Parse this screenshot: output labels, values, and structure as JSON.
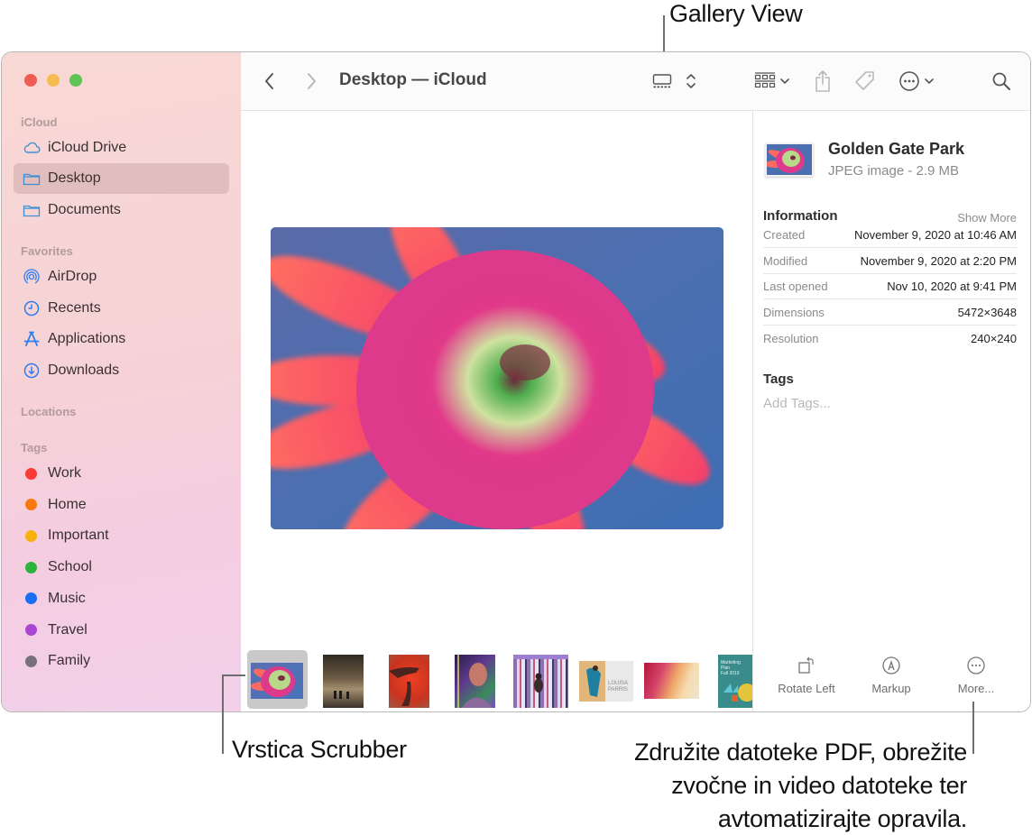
{
  "annotations": {
    "gallery_view": "Gallery View",
    "scrubber": "Vrstica Scrubber",
    "more_lines": [
      "Združite datoteke PDF, obrežite",
      "zvočne in video datoteke ter",
      "avtomatizirajte opravila."
    ]
  },
  "window": {
    "title": "Desktop — iCloud"
  },
  "sidebar": {
    "sections": [
      {
        "label": "iCloud"
      },
      {
        "label": "Favorites"
      },
      {
        "label": "Locations"
      },
      {
        "label": "Tags"
      }
    ],
    "icloud_items": [
      {
        "label": "iCloud Drive",
        "icon": "cloud-icon",
        "selected": false
      },
      {
        "label": "Desktop",
        "icon": "folder-icon",
        "selected": true
      },
      {
        "label": "Documents",
        "icon": "folder-icon",
        "selected": false
      }
    ],
    "favorite_items": [
      {
        "label": "AirDrop",
        "icon": "airdrop-icon"
      },
      {
        "label": "Recents",
        "icon": "clock-icon"
      },
      {
        "label": "Applications",
        "icon": "applications-icon"
      },
      {
        "label": "Downloads",
        "icon": "download-icon"
      }
    ],
    "tags": [
      {
        "label": "Work",
        "color": "#fa3a35"
      },
      {
        "label": "Home",
        "color": "#f7780e"
      },
      {
        "label": "Important",
        "color": "#f6b10c"
      },
      {
        "label": "School",
        "color": "#2eb33c"
      },
      {
        "label": "Music",
        "color": "#1a6ef5"
      },
      {
        "label": "Travel",
        "color": "#a845d2"
      },
      {
        "label": "Family",
        "color": "#76707a"
      }
    ]
  },
  "toolbar": {
    "back": "chevron-left-icon",
    "forward": "chevron-right-icon",
    "view_mode": "gallery-view-icon",
    "group": "group-icon",
    "share": "share-icon",
    "tag": "tag-icon",
    "more": "ellipsis-circle-icon",
    "search": "search-icon"
  },
  "inspector": {
    "file_name": "Golden Gate Park",
    "file_kind": "JPEG image - 2.9 MB",
    "information_heading": "Information",
    "show_more": "Show More",
    "rows": [
      {
        "key": "Created",
        "value": "November 9, 2020 at 10:46 AM"
      },
      {
        "key": "Modified",
        "value": "November 9, 2020 at 2:20 PM"
      },
      {
        "key": "Last opened",
        "value": "Nov 10, 2020 at 9:41 PM"
      },
      {
        "key": "Dimensions",
        "value": "5472×3648"
      },
      {
        "key": "Resolution",
        "value": "240×240"
      }
    ],
    "tags_heading": "Tags",
    "add_tags_placeholder": "Add Tags...",
    "actions": [
      {
        "label": "Rotate Left",
        "icon": "rotate-left-icon"
      },
      {
        "label": "Markup",
        "icon": "markup-icon"
      },
      {
        "label": "More...",
        "icon": "more-icon"
      }
    ]
  },
  "scrubber": {
    "thumbnails": [
      {
        "name": "flower",
        "selected": true
      },
      {
        "name": "forest-path"
      },
      {
        "name": "red-hand"
      },
      {
        "name": "portrait-neon"
      },
      {
        "name": "striped-corridor"
      },
      {
        "name": "louisa-parris-poster"
      },
      {
        "name": "abstract-gradient"
      },
      {
        "name": "marketing-plan",
        "text": "Marketing Plan Fall 2019"
      }
    ]
  }
}
